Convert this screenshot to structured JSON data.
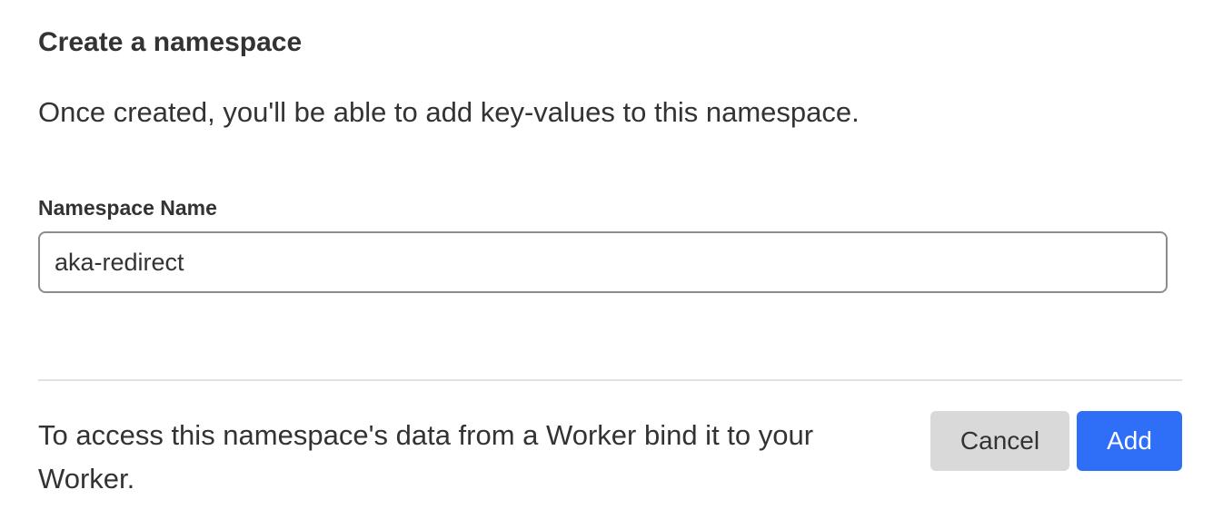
{
  "dialog": {
    "title": "Create a namespace",
    "description": "Once created, you'll be able to add key-values to this namespace.",
    "namespace_field": {
      "label": "Namespace Name",
      "value": "aka-redirect"
    },
    "footer": {
      "info_text": "To access this namespace's data from a Worker bind it to your Worker.",
      "cancel_label": "Cancel",
      "add_label": "Add"
    }
  },
  "colors": {
    "primary": "#2f6ff7",
    "secondary_button": "#d9d9d9",
    "text": "#333333",
    "input_border": "#8c8c8c",
    "divider": "#e2e2e2"
  }
}
